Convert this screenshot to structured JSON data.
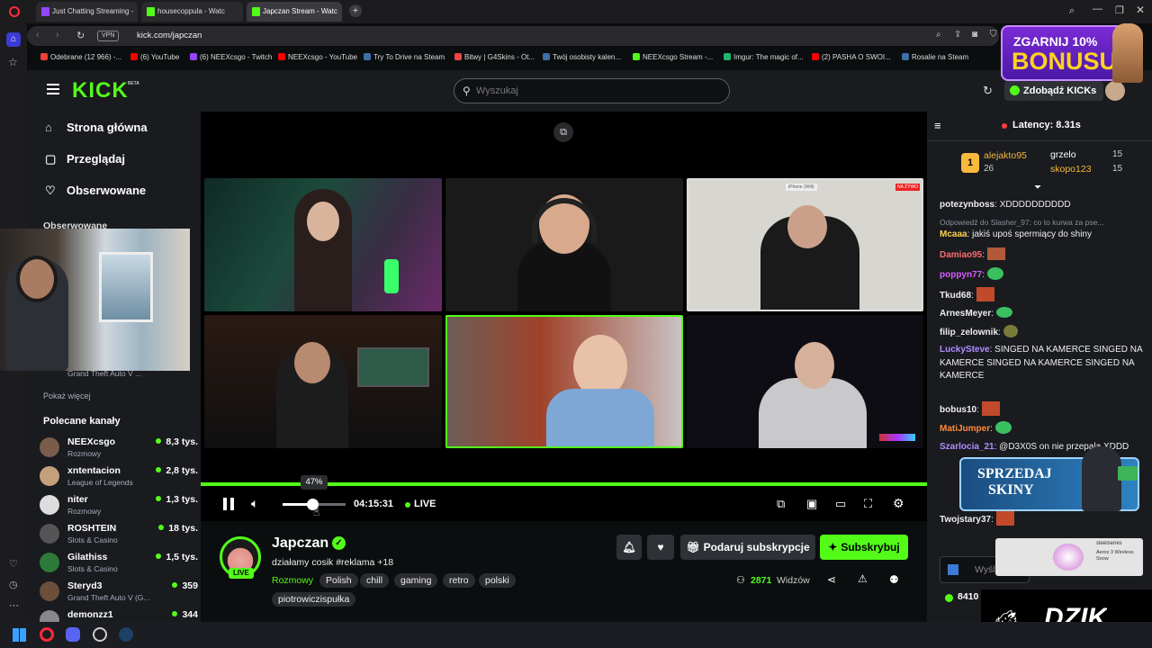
{
  "browser": {
    "tabs": [
      "Just Chatting Streaming -",
      "housecoppula - Watc",
      "Japczan Stream - Watc"
    ],
    "url": "kick.com/japczan",
    "vpn": "VPN",
    "bookmarks": [
      "Odebrane (12 966) -...",
      "(6) YouTube",
      "(6) NEEXcsgo - Twitch",
      "NEEXcsgo - YouTube",
      "Try To Drive na Steam",
      "Bitwy | G4Skins - Ot...",
      "Twój osobisty kalen...",
      "NEEXcsgo Stream -...",
      "Imgur: The magic of...",
      "(2) PASHA O SWOI...",
      "Rosalie na Steam"
    ]
  },
  "ad": {
    "line1": "ZGARNIJ 10%",
    "line2": "BONUSU"
  },
  "kick": {
    "logo": "KICK",
    "beta": "BETA",
    "search_placeholder": "Wyszukaj",
    "get_kicks": "Zdobądź KICKs"
  },
  "leftnav": {
    "items": [
      "Strona główna",
      "Przeglądaj",
      "Obserwowane"
    ],
    "followed_heading": "Obserwowane",
    "partial_category": "Grand Theft Auto V ...",
    "show_more": "Pokaż więcej",
    "recommended_heading": "Polecane kanały",
    "channels": [
      {
        "name": "NEEXcsgo",
        "category": "Rozmowy",
        "viewers": "8,3 tys."
      },
      {
        "name": "xntentacion",
        "category": "League of Legends",
        "viewers": "2,8 tys."
      },
      {
        "name": "niter",
        "category": "Rozmowy",
        "viewers": "1,3 tys."
      },
      {
        "name": "ROSHTEIN",
        "category": "Slots & Casino",
        "viewers": "18 tys."
      },
      {
        "name": "Gilathiss",
        "category": "Slots & Casino",
        "viewers": "1,5 tys."
      },
      {
        "name": "Steryd3",
        "category": "Grand Theft Auto V (G...",
        "viewers": "359"
      },
      {
        "name": "demonzz1",
        "category": "",
        "viewers": "344"
      }
    ]
  },
  "player": {
    "volume_tooltip": "47%",
    "volume_level": 0.47,
    "time": "04:15:31",
    "live": "LIVE",
    "cam_badge": "NA ŻYWO",
    "cam_label": "iPhone (Wifi)"
  },
  "stream": {
    "channel": "Japczan",
    "title": "działamy cosik #reklama +18",
    "avatar_live": "LIVE",
    "category": "Rozmowy",
    "tags": [
      "Polish",
      "chill",
      "gaming",
      "retro",
      "polski",
      "piotrowiczispułka"
    ],
    "viewers_num": "2871",
    "viewers_label": "Widzów",
    "gift_sub": "Podaruj subskrypcje",
    "subscribe": "Subskrybuj"
  },
  "chat": {
    "latency": "Latency: 8.31s",
    "leaders": [
      {
        "rank": "1",
        "name": "alejakto95",
        "count": "26"
      },
      {
        "name": "grzelo",
        "count": "15"
      },
      {
        "name": "skopo123",
        "count": "15"
      }
    ],
    "messages": [
      {
        "user": "potezynboss",
        "color": "#ffffff",
        "text": "XDDDDDDDDDD"
      },
      {
        "user": "",
        "color": "#8a8f98",
        "text": "Odpowiedź do Slasher_97: co to kurwa za pse..."
      },
      {
        "user": "Mcaaa",
        "color": "#ffd24d",
        "text": "jakiś upoś spermiący do shiny"
      },
      {
        "user": "Damiao95",
        "color": "#ff6b6b",
        "text": ""
      },
      {
        "user": "poppyn77",
        "color": "#d65cff",
        "text": ""
      },
      {
        "user": "Tkud68",
        "color": "#ffffff",
        "text": ""
      },
      {
        "user": "ArnesMeyer",
        "color": "#ffffff",
        "text": ""
      },
      {
        "user": "filip_zelownik",
        "color": "#ffffff",
        "text": ""
      },
      {
        "user": "LuckySteve",
        "color": "#b28dff",
        "text": "SINGED NA KAMERCE SINGED NA KAMERCE SINGED NA KAMERCE SINGED NA KAMERCE"
      },
      {
        "user": "bobus10",
        "color": "#ffffff",
        "text": ""
      },
      {
        "user": "MatiJumper",
        "color": "#ff8a3d",
        "text": ""
      },
      {
        "user": "Szarlocia_21",
        "color": "#b28dff",
        "text": "@D3X0S on nie przepala XDDD"
      },
      {
        "user": "Twojstary37",
        "color": "#ffffff",
        "text": ""
      }
    ],
    "input_placeholder": "Wyśl",
    "points": "8410"
  },
  "overlay": {
    "sell_line1": "SPRZEDAJ",
    "sell_line2": "SKINY",
    "brand": "DZIK",
    "steelseries": "steelseries",
    "product": "Aerox 3 Wireless Snow"
  }
}
